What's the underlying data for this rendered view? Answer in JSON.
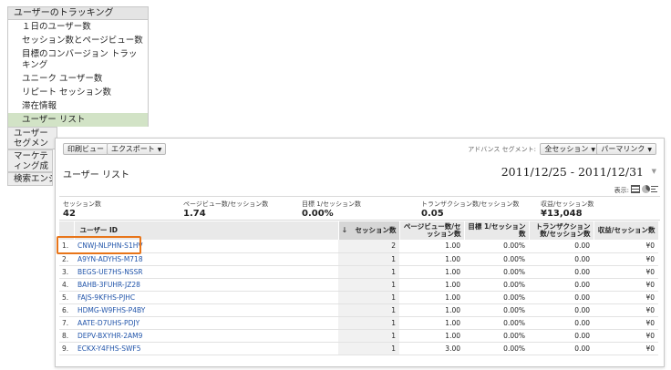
{
  "nav": {
    "header": "ユーザーのトラッキング",
    "items": [
      {
        "label": "１日のユーザー数",
        "selected": false
      },
      {
        "label": "セッション数とページビュー数",
        "selected": false
      },
      {
        "label": "目標のコンバージョン トラッキング",
        "selected": false
      },
      {
        "label": "ユニーク ユーザー数",
        "selected": false
      },
      {
        "label": "リピート セッション数",
        "selected": false
      },
      {
        "label": "滞在情報",
        "selected": false
      },
      {
        "label": "ユーザー リスト",
        "selected": true
      }
    ],
    "groups": [
      "ユーザー セグメントのパフォーマンス",
      "マーケティング成果",
      "検索エンジン"
    ]
  },
  "toolbar": {
    "print_label": "印刷ビュー",
    "export_label": "エクスポート",
    "advanced_segment_label": "アドバンス セグメント:",
    "segment_label": "全セッション",
    "permalink_label": "パーマリンク"
  },
  "report": {
    "title": "ユーザー リスト",
    "date_range": "2011/12/25 - 2011/12/31",
    "display_label": "表示:"
  },
  "summary": [
    {
      "label": "セッション数",
      "value": "42"
    },
    {
      "label": "ページビュー数/セッション数",
      "value": "1.74"
    },
    {
      "label": "目標 1/セッション数",
      "value": "0.00%"
    },
    {
      "label": "トランザクション数/セッション数",
      "value": "0.05"
    },
    {
      "label": "収益/セッション数",
      "value": "¥13,048"
    }
  ],
  "table": {
    "columns": {
      "user_id": "ユーザー ID",
      "sessions": "セッション数",
      "pv_per_session": "ページビュー数/セッション数",
      "goal_per_session": "目標 1/セッション数",
      "tx_per_session": "トランザクション数/セッション数",
      "revenue_per_session": "収益/セッション数"
    },
    "rows": [
      {
        "idx": "1.",
        "user_id": "CNWJ-NLPHN-S1HV",
        "sessions": "2",
        "pv": "1.00",
        "goal": "0.00%",
        "tx": "0.00",
        "rev": "¥0"
      },
      {
        "idx": "2.",
        "user_id": "A9YN-ADYHS-M718",
        "sessions": "1",
        "pv": "1.00",
        "goal": "0.00%",
        "tx": "0.00",
        "rev": "¥0"
      },
      {
        "idx": "3.",
        "user_id": "BEGS-UE7HS-NSSR",
        "sessions": "1",
        "pv": "1.00",
        "goal": "0.00%",
        "tx": "0.00",
        "rev": "¥0"
      },
      {
        "idx": "4.",
        "user_id": "BAHB-3FUHR-JZ28",
        "sessions": "1",
        "pv": "1.00",
        "goal": "0.00%",
        "tx": "0.00",
        "rev": "¥0"
      },
      {
        "idx": "5.",
        "user_id": "FAJS-9KFHS-PJHC",
        "sessions": "1",
        "pv": "1.00",
        "goal": "0.00%",
        "tx": "0.00",
        "rev": "¥0"
      },
      {
        "idx": "6.",
        "user_id": "HDMG-W9FHS-P4BY",
        "sessions": "1",
        "pv": "1.00",
        "goal": "0.00%",
        "tx": "0.00",
        "rev": "¥0"
      },
      {
        "idx": "7.",
        "user_id": "AATE-D7UHS-PDJY",
        "sessions": "1",
        "pv": "1.00",
        "goal": "0.00%",
        "tx": "0.00",
        "rev": "¥0"
      },
      {
        "idx": "8.",
        "user_id": "DEPV-BXYHR-2AM9",
        "sessions": "1",
        "pv": "1.00",
        "goal": "0.00%",
        "tx": "0.00",
        "rev": "¥0"
      },
      {
        "idx": "9.",
        "user_id": "ECKX-Y4FHS-SWF5",
        "sessions": "1",
        "pv": "3.00",
        "goal": "0.00%",
        "tx": "0.00",
        "rev": "¥0"
      }
    ]
  },
  "colors": {
    "selected_nav": "#d2e3c6",
    "link": "#2255aa",
    "highlight": "#e8751a"
  }
}
